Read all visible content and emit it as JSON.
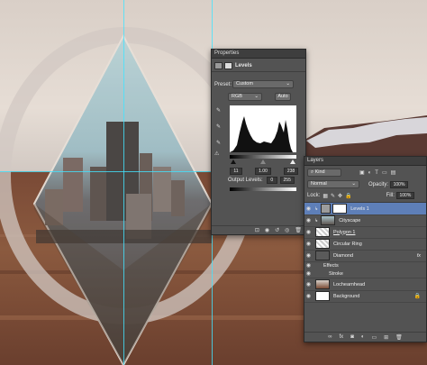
{
  "properties": {
    "tab_label": "Properties",
    "adjustment_label": "Levels",
    "preset_label": "Preset:",
    "preset_value": "Custom",
    "channel_value": "RGB",
    "auto_label": "Auto",
    "input_black": "11",
    "input_gamma": "1.00",
    "input_white": "238",
    "output_label": "Output Levels:",
    "output_black": "0",
    "output_white": "255"
  },
  "layers": {
    "tab_label": "Layers",
    "filter_kind": "Kind",
    "blend_mode": "Normal",
    "opacity_label": "Opacity:",
    "opacity_value": "100%",
    "lock_label": "Lock:",
    "fill_label": "Fill:",
    "fill_value": "100%",
    "items": [
      {
        "name": "Levels 1",
        "selected": true
      },
      {
        "name": "Cityscape",
        "selected": false
      },
      {
        "name": "Polygon 1",
        "selected": false
      },
      {
        "name": "Circular Ring",
        "selected": false
      },
      {
        "name": "Diamond",
        "selected": false,
        "fx": "fx"
      },
      {
        "name": "Effects",
        "sub": true
      },
      {
        "name": "Stroke",
        "sub": true
      },
      {
        "name": "Lochearnhead",
        "selected": false
      },
      {
        "name": "Background",
        "selected": false
      }
    ]
  },
  "colors": {
    "guide": "#42e3ff",
    "panel_bg": "#535353",
    "selection": "#5e7fb8"
  }
}
